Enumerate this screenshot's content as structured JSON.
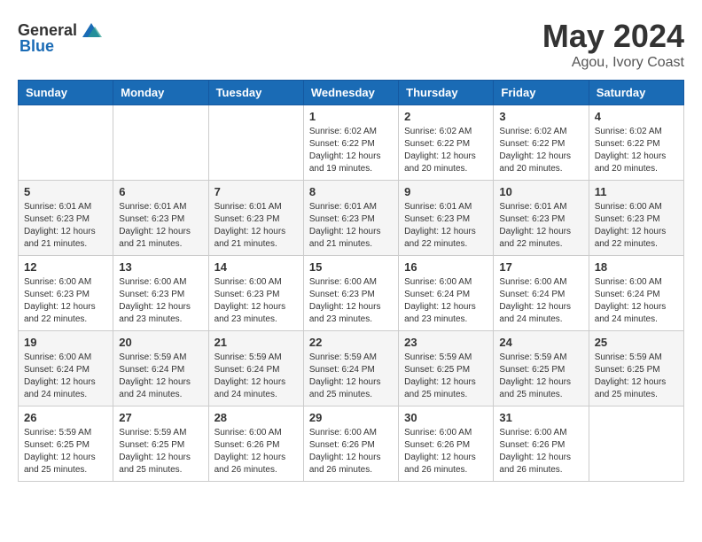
{
  "header": {
    "logo_general": "General",
    "logo_blue": "Blue",
    "month_year": "May 2024",
    "location": "Agou, Ivory Coast"
  },
  "weekdays": [
    "Sunday",
    "Monday",
    "Tuesday",
    "Wednesday",
    "Thursday",
    "Friday",
    "Saturday"
  ],
  "weeks": [
    [
      {
        "day": "",
        "info": ""
      },
      {
        "day": "",
        "info": ""
      },
      {
        "day": "",
        "info": ""
      },
      {
        "day": "1",
        "info": "Sunrise: 6:02 AM\nSunset: 6:22 PM\nDaylight: 12 hours\nand 19 minutes."
      },
      {
        "day": "2",
        "info": "Sunrise: 6:02 AM\nSunset: 6:22 PM\nDaylight: 12 hours\nand 20 minutes."
      },
      {
        "day": "3",
        "info": "Sunrise: 6:02 AM\nSunset: 6:22 PM\nDaylight: 12 hours\nand 20 minutes."
      },
      {
        "day": "4",
        "info": "Sunrise: 6:02 AM\nSunset: 6:22 PM\nDaylight: 12 hours\nand 20 minutes."
      }
    ],
    [
      {
        "day": "5",
        "info": "Sunrise: 6:01 AM\nSunset: 6:23 PM\nDaylight: 12 hours\nand 21 minutes."
      },
      {
        "day": "6",
        "info": "Sunrise: 6:01 AM\nSunset: 6:23 PM\nDaylight: 12 hours\nand 21 minutes."
      },
      {
        "day": "7",
        "info": "Sunrise: 6:01 AM\nSunset: 6:23 PM\nDaylight: 12 hours\nand 21 minutes."
      },
      {
        "day": "8",
        "info": "Sunrise: 6:01 AM\nSunset: 6:23 PM\nDaylight: 12 hours\nand 21 minutes."
      },
      {
        "day": "9",
        "info": "Sunrise: 6:01 AM\nSunset: 6:23 PM\nDaylight: 12 hours\nand 22 minutes."
      },
      {
        "day": "10",
        "info": "Sunrise: 6:01 AM\nSunset: 6:23 PM\nDaylight: 12 hours\nand 22 minutes."
      },
      {
        "day": "11",
        "info": "Sunrise: 6:00 AM\nSunset: 6:23 PM\nDaylight: 12 hours\nand 22 minutes."
      }
    ],
    [
      {
        "day": "12",
        "info": "Sunrise: 6:00 AM\nSunset: 6:23 PM\nDaylight: 12 hours\nand 22 minutes."
      },
      {
        "day": "13",
        "info": "Sunrise: 6:00 AM\nSunset: 6:23 PM\nDaylight: 12 hours\nand 23 minutes."
      },
      {
        "day": "14",
        "info": "Sunrise: 6:00 AM\nSunset: 6:23 PM\nDaylight: 12 hours\nand 23 minutes."
      },
      {
        "day": "15",
        "info": "Sunrise: 6:00 AM\nSunset: 6:23 PM\nDaylight: 12 hours\nand 23 minutes."
      },
      {
        "day": "16",
        "info": "Sunrise: 6:00 AM\nSunset: 6:24 PM\nDaylight: 12 hours\nand 23 minutes."
      },
      {
        "day": "17",
        "info": "Sunrise: 6:00 AM\nSunset: 6:24 PM\nDaylight: 12 hours\nand 24 minutes."
      },
      {
        "day": "18",
        "info": "Sunrise: 6:00 AM\nSunset: 6:24 PM\nDaylight: 12 hours\nand 24 minutes."
      }
    ],
    [
      {
        "day": "19",
        "info": "Sunrise: 6:00 AM\nSunset: 6:24 PM\nDaylight: 12 hours\nand 24 minutes."
      },
      {
        "day": "20",
        "info": "Sunrise: 5:59 AM\nSunset: 6:24 PM\nDaylight: 12 hours\nand 24 minutes."
      },
      {
        "day": "21",
        "info": "Sunrise: 5:59 AM\nSunset: 6:24 PM\nDaylight: 12 hours\nand 24 minutes."
      },
      {
        "day": "22",
        "info": "Sunrise: 5:59 AM\nSunset: 6:24 PM\nDaylight: 12 hours\nand 25 minutes."
      },
      {
        "day": "23",
        "info": "Sunrise: 5:59 AM\nSunset: 6:25 PM\nDaylight: 12 hours\nand 25 minutes."
      },
      {
        "day": "24",
        "info": "Sunrise: 5:59 AM\nSunset: 6:25 PM\nDaylight: 12 hours\nand 25 minutes."
      },
      {
        "day": "25",
        "info": "Sunrise: 5:59 AM\nSunset: 6:25 PM\nDaylight: 12 hours\nand 25 minutes."
      }
    ],
    [
      {
        "day": "26",
        "info": "Sunrise: 5:59 AM\nSunset: 6:25 PM\nDaylight: 12 hours\nand 25 minutes."
      },
      {
        "day": "27",
        "info": "Sunrise: 5:59 AM\nSunset: 6:25 PM\nDaylight: 12 hours\nand 25 minutes."
      },
      {
        "day": "28",
        "info": "Sunrise: 6:00 AM\nSunset: 6:26 PM\nDaylight: 12 hours\nand 26 minutes."
      },
      {
        "day": "29",
        "info": "Sunrise: 6:00 AM\nSunset: 6:26 PM\nDaylight: 12 hours\nand 26 minutes."
      },
      {
        "day": "30",
        "info": "Sunrise: 6:00 AM\nSunset: 6:26 PM\nDaylight: 12 hours\nand 26 minutes."
      },
      {
        "day": "31",
        "info": "Sunrise: 6:00 AM\nSunset: 6:26 PM\nDaylight: 12 hours\nand 26 minutes."
      },
      {
        "day": "",
        "info": ""
      }
    ]
  ]
}
